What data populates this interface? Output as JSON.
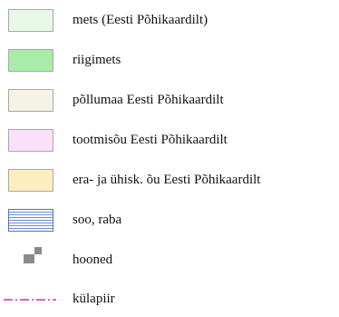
{
  "legend": {
    "items": [
      {
        "label": "mets (Eesti Põhikaardilt)",
        "color": "#e8f8e8",
        "symbol": "filled-box"
      },
      {
        "label": "riigimets",
        "color": "#a8eca8",
        "symbol": "filled-box"
      },
      {
        "label": "põllumaa Eesti Põhikaardilt",
        "color": "#f6f3e6",
        "symbol": "filled-box"
      },
      {
        "label": "tootmisõu Eesti Põhikaardilt",
        "color": "#fbe0fb",
        "symbol": "filled-box"
      },
      {
        "label": "era- ja ühisk. õu Eesti Põhikaardilt",
        "color": "#fdeec0",
        "symbol": "filled-box"
      },
      {
        "label": "soo, raba",
        "color": "#6b8fd3",
        "symbol": "hatched-box"
      },
      {
        "label": "hooned",
        "color": "#8a8a8a",
        "symbol": "building-icon"
      },
      {
        "label": "külapiir",
        "color": "#d0319a",
        "symbol": "dash-dot-line"
      }
    ]
  }
}
